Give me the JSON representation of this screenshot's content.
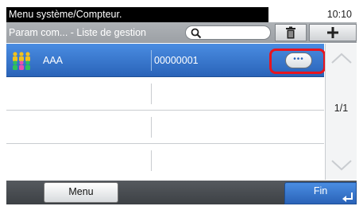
{
  "titlebar": {
    "title": "Menu système/Compteur.",
    "time": "10:10"
  },
  "subheader": {
    "title": "Param com... - Liste de gestion",
    "search_value": "",
    "delete_icon": "trash-icon",
    "add_icon": "plus-icon"
  },
  "list": {
    "rows": [
      {
        "icon": "group-users-icon",
        "name": "AAA",
        "id": "00000001",
        "selected": true,
        "detail_icon": "ellipsis-icon"
      },
      {
        "name": "",
        "id": ""
      },
      {
        "name": "",
        "id": ""
      },
      {
        "name": "",
        "id": ""
      }
    ]
  },
  "scroll": {
    "page": "1/1",
    "up_icon": "chevron-up-icon",
    "down_icon": "chevron-down-icon"
  },
  "bottombar": {
    "menu_label": "Menu",
    "fin_label": "Fin",
    "enter_icon": "enter-arrow-icon"
  },
  "colors": {
    "selection": "#2a63b8",
    "highlight": "#e8141e",
    "header": "#9ca0a5"
  }
}
